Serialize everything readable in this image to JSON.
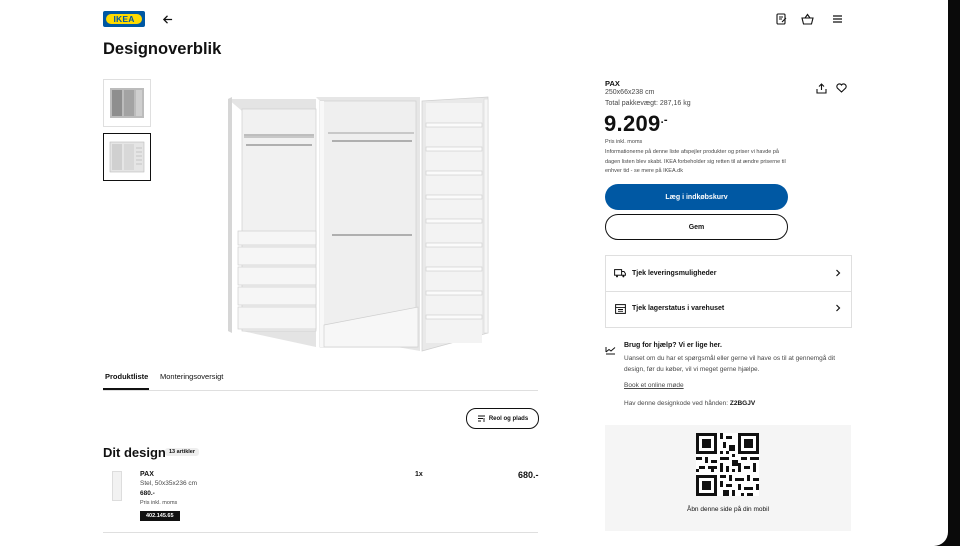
{
  "header": {
    "logo_text": "IKEA",
    "icons": [
      "back-arrow-icon",
      "shopping-list-icon",
      "basket-icon",
      "menu-icon"
    ]
  },
  "page_title": "Designoverblik",
  "tabs": [
    {
      "label": "Produktliste",
      "active": true
    },
    {
      "label": "Monteringsoversigt",
      "active": false
    }
  ],
  "room_button_label": "Reol og plads",
  "design": {
    "title": "Dit design",
    "count_label": "13 artikler",
    "items": [
      {
        "name": "PAX",
        "description": "Stel, 50x35x236 cm",
        "price": "680.-",
        "price_note": "Pris inkl. moms",
        "article_number": "402.145.65",
        "quantity": "1x",
        "total": "680.-"
      }
    ]
  },
  "product": {
    "name": "PAX",
    "dimensions": "250x66x238 cm",
    "weight": "Total pakkevægt: 287,16 kg",
    "price": "9.209",
    "price_suffix": ".-",
    "price_note": "Pris inkl. moms",
    "disclaimer": "Informationerne på denne liste afspejler produkter og priser vi havde på dagen listen blev skabt. IKEA forbeholder sig retten til at ændre priserne til enhver tid - se mere på IKEA.dk",
    "add_to_cart": "Læg i indkøbskurv",
    "save": "Gem"
  },
  "options": [
    {
      "label": "Tjek leveringsmuligheder",
      "icon": "truck-icon"
    },
    {
      "label": "Tjek lagerstatus i varehuset",
      "icon": "store-icon"
    }
  ],
  "help": {
    "title": "Brug for hjælp? Vi er lige her.",
    "text": "Uanset om du har et spørgsmål eller gerne vil have os til at gennemgå dit design, før du køber, vil vi meget gerne hjælpe.",
    "link": "Book et online møde",
    "code_prefix": "Hav denne designkode ved hånden:",
    "code": "Z2BGJV"
  },
  "qr": {
    "caption": "Åbn denne side på din mobil"
  },
  "colors": {
    "ikea_blue": "#0058a3",
    "ikea_yellow": "#ffdb00"
  }
}
